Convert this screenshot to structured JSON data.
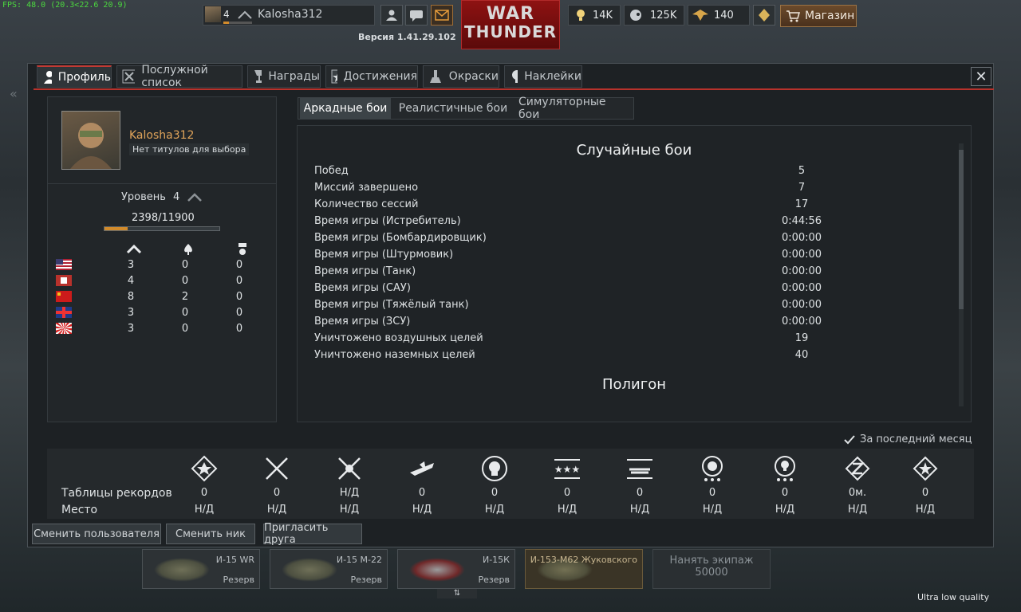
{
  "hud": {
    "fps": "FPS: 48.0 (20.3<22.6 20.9)",
    "version": "Версия 1.41.29.102",
    "quality": "Ultra low quality"
  },
  "topbar": {
    "rank": "4",
    "username": "Kalosha312",
    "logo_top": "WAR",
    "logo_bottom": "THUNDER",
    "research_points": "14K",
    "silver_lions": "125K",
    "golden_eagles": "140",
    "shop_label": "Магазин"
  },
  "tabs": [
    {
      "label": "Профиль",
      "icon": "profile-icon"
    },
    {
      "label": "Послужной список",
      "icon": "record-icon"
    },
    {
      "label": "Награды",
      "icon": "awards-icon"
    },
    {
      "label": "Достижения",
      "icon": "achievements-icon"
    },
    {
      "label": "Окраски",
      "icon": "skins-icon"
    },
    {
      "label": "Наклейки",
      "icon": "decals-icon"
    }
  ],
  "profile": {
    "name": "Kalosha312",
    "title": "Нет титулов для выбора",
    "level_label": "Уровень",
    "level": "4",
    "xp": "2398/11900",
    "xp_fraction": 0.2015,
    "nations": [
      {
        "nation": "usa",
        "r1": "3",
        "r2": "0",
        "r3": "0"
      },
      {
        "nation": "germany",
        "r1": "4",
        "r2": "0",
        "r3": "0"
      },
      {
        "nation": "ussr",
        "r1": "8",
        "r2": "2",
        "r3": "0"
      },
      {
        "nation": "britain",
        "r1": "3",
        "r2": "0",
        "r3": "0"
      },
      {
        "nation": "japan",
        "r1": "3",
        "r2": "0",
        "r3": "0"
      }
    ]
  },
  "modes": {
    "arcade": "Аркадные бои",
    "realistic": "Реалистичные бои",
    "simulator": "Симуляторные бои"
  },
  "stats": {
    "section1": "Случайные бои",
    "section2": "Полигон",
    "rows": [
      {
        "label": "Побед",
        "value": "5"
      },
      {
        "label": "Миссий завершено",
        "value": "7"
      },
      {
        "label": "Количество сессий",
        "value": "17"
      },
      {
        "label": "Время игры (Истребитель)",
        "value": "0:44:56"
      },
      {
        "label": "Время игры (Бомбардировщик)",
        "value": "0:00:00"
      },
      {
        "label": "Время игры (Штурмовик)",
        "value": "0:00:00"
      },
      {
        "label": "Время игры (Танк)",
        "value": "0:00:00"
      },
      {
        "label": "Время игры (САУ)",
        "value": "0:00:00"
      },
      {
        "label": "Время игры (Тяжёлый танк)",
        "value": "0:00:00"
      },
      {
        "label": "Время игры (ЗСУ)",
        "value": "0:00:00"
      },
      {
        "label": "Уничтожено воздушных целей",
        "value": "19"
      },
      {
        "label": "Уничтожено наземных целей",
        "value": "40"
      }
    ]
  },
  "leaderboard": {
    "last_month": "За последний месяц",
    "row1_label": "Таблицы рекордов",
    "row2_label": "Место",
    "columns": [
      {
        "icon": "victories-icon",
        "value": "0",
        "place": "Н/Д"
      },
      {
        "icon": "swords-icon",
        "value": "0",
        "place": "Н/Д"
      },
      {
        "icon": "crossed-swords-icon",
        "value": "Н/Д",
        "place": "Н/Д"
      },
      {
        "icon": "plane-kills-icon",
        "value": "0",
        "place": "Н/Д"
      },
      {
        "icon": "skull-icon",
        "value": "0",
        "place": "Н/Д"
      },
      {
        "icon": "stars-icon",
        "value": "0",
        "place": "Н/Д"
      },
      {
        "icon": "wings-icon",
        "value": "0",
        "place": "Н/Д"
      },
      {
        "icon": "lion-icon",
        "value": "0",
        "place": "Н/Д"
      },
      {
        "icon": "bulb-icon",
        "value": "0",
        "place": "Н/Д"
      },
      {
        "icon": "time-icon",
        "value": "0м.",
        "place": "Н/Д"
      },
      {
        "icon": "rating-icon",
        "value": "0",
        "place": "Н/Д"
      }
    ]
  },
  "buttons": {
    "change_user": "Сменить пользователя",
    "change_nick": "Сменить ник",
    "invite": "Пригласить друга"
  },
  "hangar": {
    "slots": [
      {
        "name": "И-15 WR",
        "status": "Резерв"
      },
      {
        "name": "И-15 М-22",
        "status": "Резерв"
      },
      {
        "name": "И-15К",
        "status": "Резерв"
      },
      {
        "name": "И-153-М62 Жуковского",
        "status": ""
      }
    ],
    "hire_crew": "Нанять экипаж",
    "hire_cost": "50000"
  }
}
